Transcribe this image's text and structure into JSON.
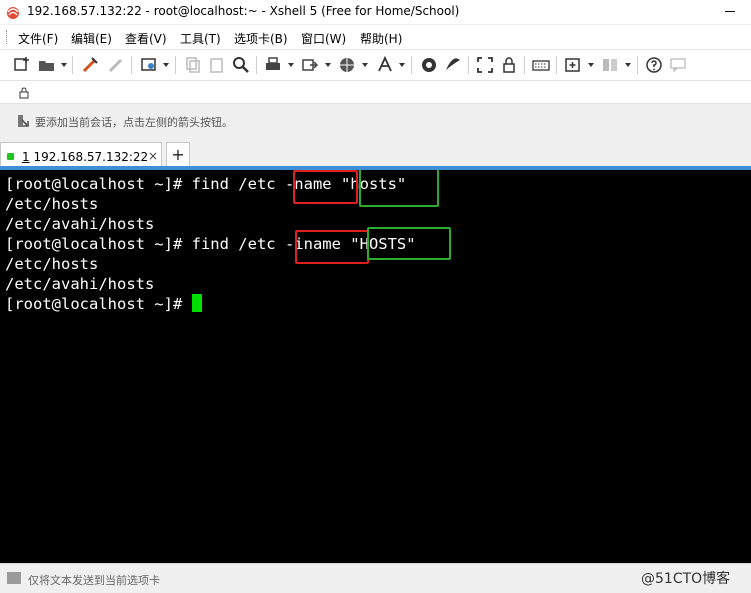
{
  "window": {
    "title": "192.168.57.132:22 - root@localhost:~ - Xshell 5 (Free for Home/School)"
  },
  "menu": {
    "items": [
      "文件(F)",
      "编辑(E)",
      "查看(V)",
      "工具(T)",
      "选项卡(B)",
      "窗口(W)",
      "帮助(H)"
    ]
  },
  "hint": {
    "text": "要添加当前会话，点击左侧的箭头按钮。"
  },
  "tabs": {
    "active_number": "1",
    "active_label": " 192.168.57.132:22",
    "close": "×",
    "add": "+"
  },
  "terminal": {
    "lines": [
      "[root@localhost ~]# find /etc -name \"hosts\"",
      "/etc/hosts",
      "/etc/avahi/hosts",
      "[root@localhost ~]# find /etc -iname \"HOSTS\"",
      "/etc/hosts",
      "/etc/avahi/hosts",
      "[root@localhost ~]# "
    ]
  },
  "status": {
    "text": "仅将文本发送到当前选项卡",
    "watermark": "@51CTO博客"
  },
  "colors": {
    "terminal_bg": "#000000",
    "terminal_fg": "#ffffff",
    "cursor": "#00e000",
    "highlight_red": "#e02020",
    "highlight_green": "#2eab2e",
    "tab_accent": "#3d8fd6",
    "connected_dot": "#1fc21f"
  }
}
